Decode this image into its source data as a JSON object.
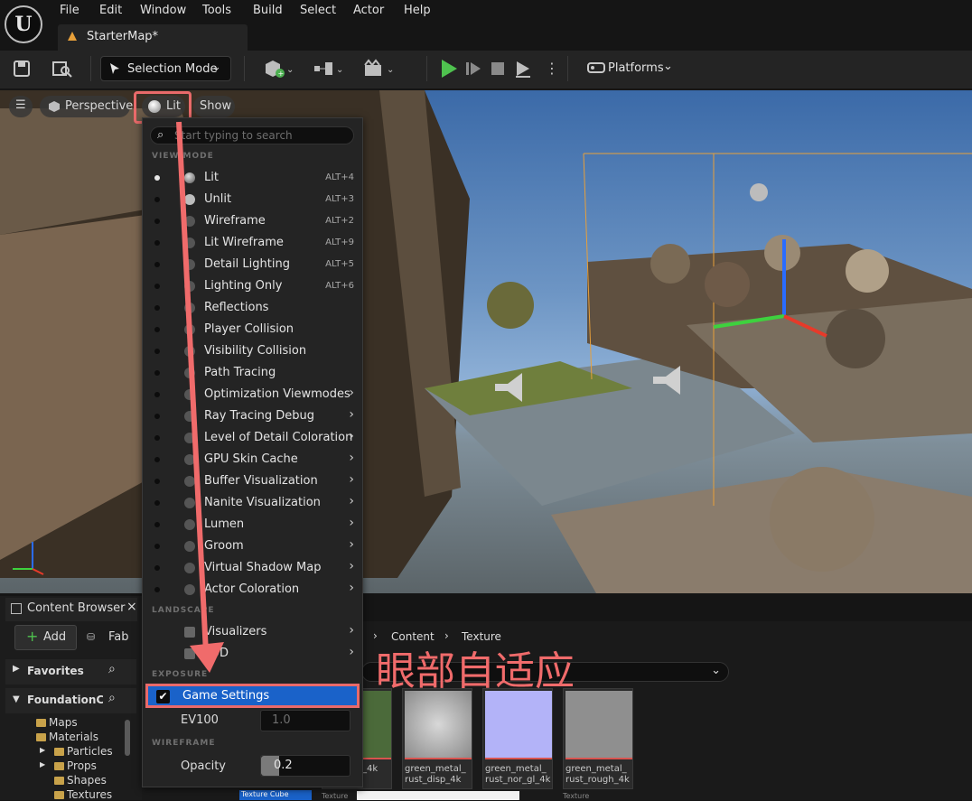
{
  "menu": [
    "File",
    "Edit",
    "Window",
    "Tools",
    "Build",
    "Select",
    "Actor",
    "Help"
  ],
  "map_tab": "StarterMap*",
  "toolbar": {
    "selection_mode": "Selection Mode",
    "platforms": "Platforms"
  },
  "viewport": {
    "perspective": "Perspective",
    "lit": "Lit",
    "show": "Show"
  },
  "dropdown": {
    "search_placeholder": "Start typing to search",
    "section_viewmode": "VIEW MODE",
    "section_landscape": "LANDSCAPE",
    "section_exposure": "EXPOSURE",
    "section_wireframe": "WIREFRAME",
    "view_modes": [
      {
        "label": "Lit",
        "shortcut": "ALT+4"
      },
      {
        "label": "Unlit",
        "shortcut": "ALT+3"
      },
      {
        "label": "Wireframe",
        "shortcut": "ALT+2"
      },
      {
        "label": "Lit Wireframe",
        "shortcut": "ALT+9"
      },
      {
        "label": "Detail Lighting",
        "shortcut": "ALT+5"
      },
      {
        "label": "Lighting Only",
        "shortcut": "ALT+6"
      },
      {
        "label": "Reflections",
        "shortcut": ""
      },
      {
        "label": "Player Collision",
        "shortcut": ""
      },
      {
        "label": "Visibility Collision",
        "shortcut": ""
      },
      {
        "label": "Path Tracing",
        "shortcut": ""
      },
      {
        "label": "Optimization Viewmodes",
        "shortcut": ""
      },
      {
        "label": "Ray Tracing Debug",
        "shortcut": ""
      },
      {
        "label": "Level of Detail Coloration",
        "shortcut": ""
      },
      {
        "label": "GPU Skin Cache",
        "shortcut": ""
      },
      {
        "label": "Buffer Visualization",
        "shortcut": ""
      },
      {
        "label": "Nanite Visualization",
        "shortcut": ""
      },
      {
        "label": "Lumen",
        "shortcut": ""
      },
      {
        "label": "Groom",
        "shortcut": ""
      },
      {
        "label": "Virtual Shadow Map",
        "shortcut": ""
      },
      {
        "label": "Actor Coloration",
        "shortcut": ""
      }
    ],
    "landscape_items": [
      "Visualizers",
      "LOD"
    ],
    "game_settings": "Game Settings",
    "ev100_label": "EV100",
    "ev100_value": "1.0",
    "opacity_label": "Opacity",
    "opacity_value": "0.2"
  },
  "annotation_text": "眼部自适应",
  "content_browser": {
    "tab": "Content Browser",
    "add": "Add",
    "fab": "Fab",
    "favorites": "Favorites",
    "foundation": "FoundationCou",
    "breadcrumb": [
      "Content",
      "Texture"
    ],
    "folders": [
      "Maps",
      "Materials",
      "Particles",
      "Props",
      "Shapes",
      "Textures"
    ],
    "assets": [
      {
        "label": "green_metal_\nrust_disp_4k"
      },
      {
        "label": "green_metal_\nrust_nor_gl_4k"
      },
      {
        "label": "green_metal_\nrust_rough_4k"
      }
    ],
    "partial_asset_label": "_4k",
    "texture_cube": "Texture Cube",
    "texture_small": "Texture"
  }
}
